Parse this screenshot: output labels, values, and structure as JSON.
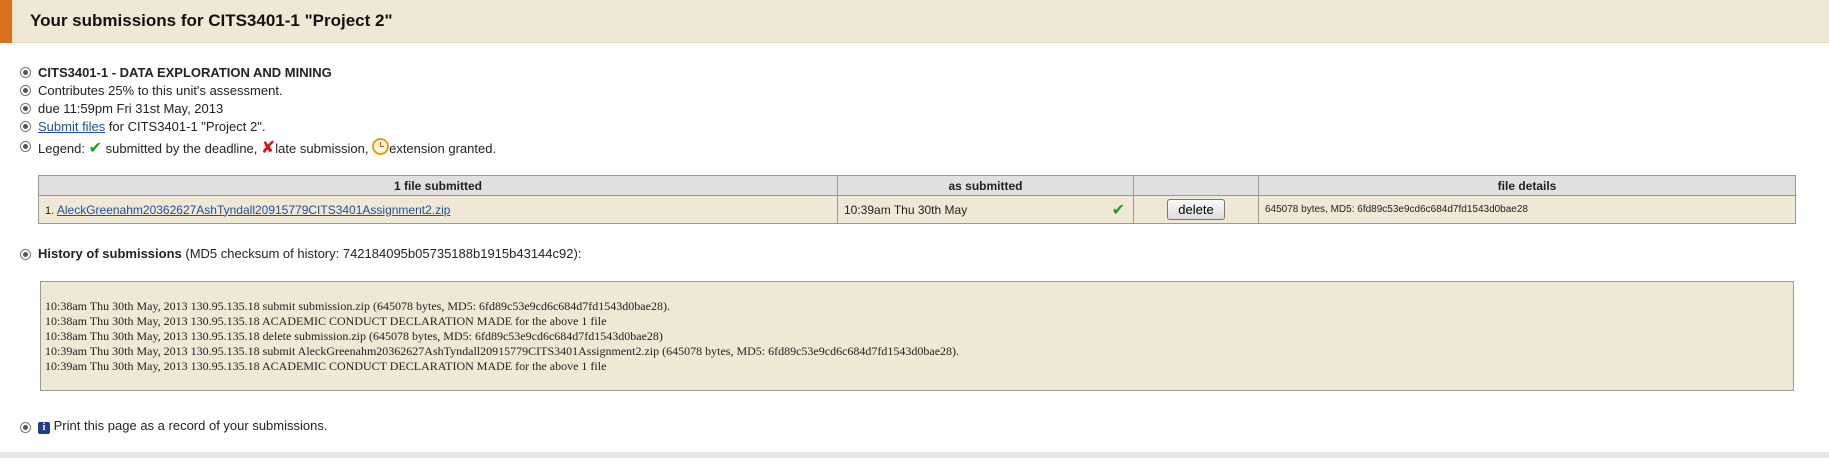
{
  "header": {
    "title": "Your submissions for CITS3401-1 \"Project 2\""
  },
  "info": {
    "unit": "CITS3401-1 - DATA EXPLORATION AND MINING",
    "contribution": "Contributes 25% to this unit's assessment.",
    "due": "due 11:59pm Fri 31st May, 2013",
    "submit_link": "Submit files",
    "submit_suffix": " for CITS3401-1 \"Project 2\".",
    "legend_label": "Legend: ",
    "legend_on_time": " submitted by the deadline, ",
    "legend_late": "late submission, ",
    "legend_extension": "extension granted."
  },
  "files_table": {
    "headers": [
      "1 file submitted",
      "as submitted",
      "",
      "file details"
    ],
    "rows": [
      {
        "index": "1.",
        "filename": "AleckGreenahm20362627AshTyndall20915779CITS3401Assignment2.zip",
        "submitted_at": "10:39am Thu 30th May",
        "status_icon": "check-icon",
        "action": "delete",
        "details": "645078 bytes, MD5: 6fd89c53e9cd6c684d7fd1543d0bae28"
      }
    ]
  },
  "history": {
    "label": "History of submissions",
    "checksum_text": " (MD5 checksum of history: 742184095b05735188b1915b43144c92):",
    "lines": [
      "10:38am Thu 30th May, 2013 130.95.135.18 submit  submission.zip (645078 bytes, MD5: 6fd89c53e9cd6c684d7fd1543d0bae28).",
      "10:38am Thu 30th May, 2013 130.95.135.18 ACADEMIC CONDUCT DECLARATION MADE for the above 1 file",
      "10:38am Thu 30th May, 2013 130.95.135.18 delete  submission.zip (645078 bytes, MD5: 6fd89c53e9cd6c684d7fd1543d0bae28)",
      "10:39am Thu 30th May, 2013 130.95.135.18 submit  AleckGreenahm20362627AshTyndall20915779CITS3401Assignment2.zip (645078 bytes, MD5: 6fd89c53e9cd6c684d7fd1543d0bae28).",
      "10:39am Thu 30th May, 2013 130.95.135.18 ACADEMIC CONDUCT DECLARATION MADE for the above 1 file"
    ]
  },
  "footer": {
    "print_note": " Print this page as a record of your submissions."
  },
  "icons": {
    "check": "✔",
    "cross": "✘",
    "info": "i"
  },
  "colors": {
    "accent": "#d8701f",
    "panel": "#efe8d4",
    "link": "#1f4f9e",
    "ok": "#1f9e1f",
    "late": "#d21a1a"
  }
}
